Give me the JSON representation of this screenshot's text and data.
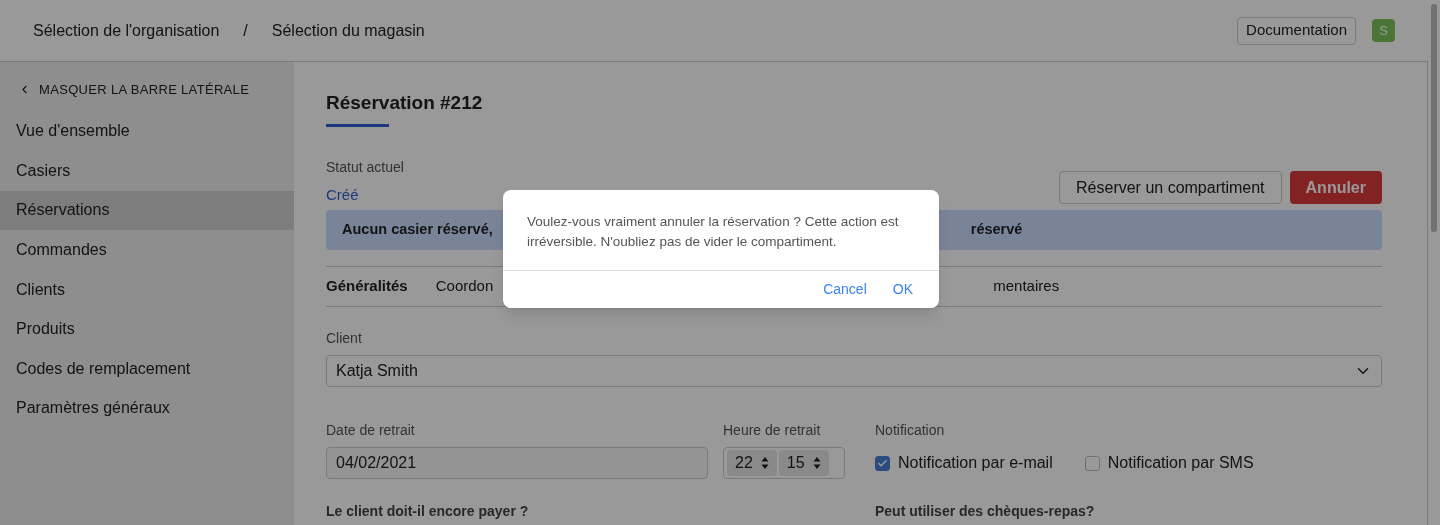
{
  "header": {
    "breadcrumbs": [
      "Sélection de l'organisation",
      "/",
      "Sélection du magasin"
    ],
    "documentation": "Documentation",
    "avatar": "S"
  },
  "sidebar": {
    "toggle": "MASQUER LA BARRE LATÉRALE",
    "items": [
      {
        "label": "Vue d'ensemble",
        "selected": false
      },
      {
        "label": "Casiers",
        "selected": false
      },
      {
        "label": "Réservations",
        "selected": true
      },
      {
        "label": "Commandes",
        "selected": false
      },
      {
        "label": "Clients",
        "selected": false
      },
      {
        "label": "Produits",
        "selected": false
      },
      {
        "label": "Codes de remplacement",
        "selected": false
      },
      {
        "label": "Paramètres généraux",
        "selected": false
      }
    ]
  },
  "main": {
    "title": "Réservation #212",
    "status_label": "Statut actuel",
    "status_value": "Créé",
    "buttons": [
      {
        "label": "Réserver un compartiment",
        "kind": "secondary"
      },
      {
        "label": "Annuler",
        "kind": "danger"
      }
    ],
    "alert": {
      "left": "Aucun casier réservé,",
      "right": "réservé"
    },
    "tabs": [
      {
        "label": "Généralités",
        "selected": true
      },
      {
        "label": "Coordon",
        "selected": false
      },
      {
        "label": "mentaires",
        "selected": false
      }
    ],
    "client": {
      "label": "Client",
      "value": "Katja Smith"
    },
    "date": {
      "label": "Date de retrait",
      "value": "04/02/2021"
    },
    "time": {
      "label": "Heure de retrait",
      "hour": "22",
      "minute": "15"
    },
    "notification": {
      "label": "Notification",
      "options": [
        {
          "label": "Notification par e-mail",
          "checked": true
        },
        {
          "label": "Notification par SMS",
          "checked": false
        }
      ]
    },
    "bottom_labels": [
      "Le client doit-il encore payer ?",
      "Peut utiliser des chèques-repas?"
    ]
  },
  "dialog": {
    "message": "Voulez-vous vraiment annuler la réservation ? Cette action est irréversible. N'oubliez pas de vider le compartiment.",
    "buttons": [
      "Cancel",
      "OK"
    ]
  }
}
